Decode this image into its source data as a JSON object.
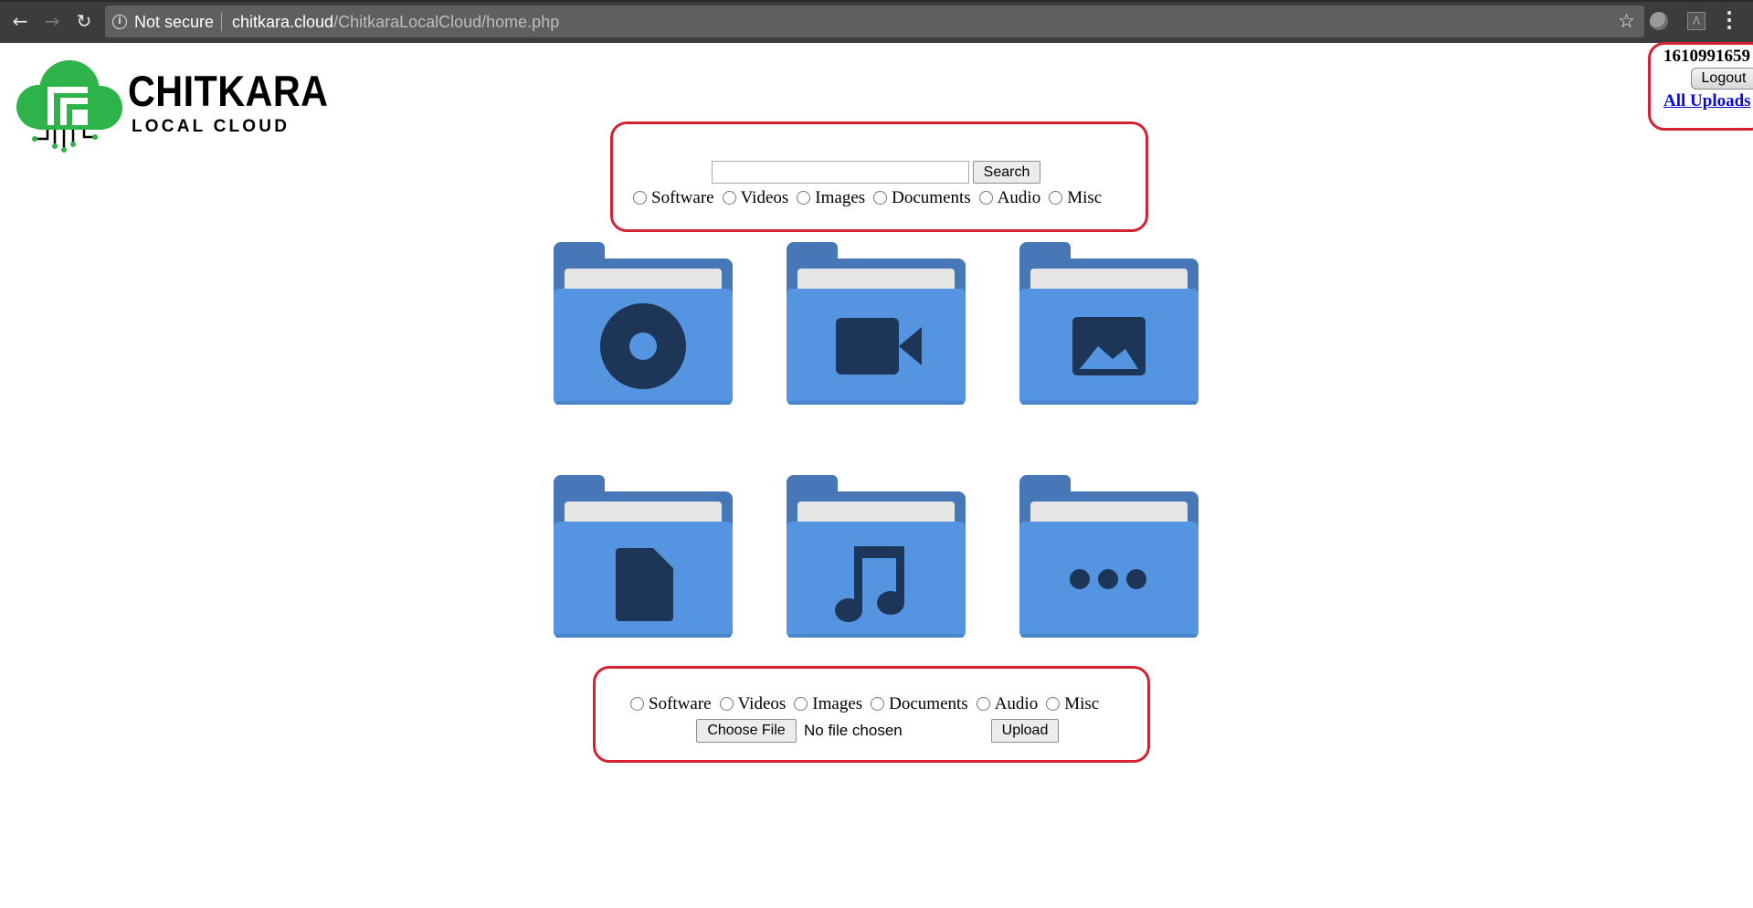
{
  "browser": {
    "security_label": "Not secure",
    "url_host": "chitkara.cloud",
    "url_path": "/ChitkaraLocalCloud/home.php"
  },
  "logo": {
    "title": "CHITKARA",
    "subtitle": "LOCAL CLOUD",
    "colors": {
      "cloud": "#2db34a",
      "text": "#000000"
    }
  },
  "user": {
    "id": "1610991659",
    "logout_label": "Logout",
    "all_uploads_label": "All Uploads"
  },
  "search": {
    "input_value": "",
    "button_label": "Search",
    "categories": [
      "Software",
      "Videos",
      "Images",
      "Documents",
      "Audio",
      "Misc"
    ]
  },
  "folders": [
    {
      "category": "Software",
      "icon": "disc-icon"
    },
    {
      "category": "Videos",
      "icon": "video-camera-icon"
    },
    {
      "category": "Images",
      "icon": "image-icon"
    },
    {
      "category": "Documents",
      "icon": "document-icon"
    },
    {
      "category": "Audio",
      "icon": "music-note-icon"
    },
    {
      "category": "Misc",
      "icon": "more-dots-icon"
    }
  ],
  "upload": {
    "categories": [
      "Software",
      "Videos",
      "Images",
      "Documents",
      "Audio",
      "Misc"
    ],
    "choose_file_label": "Choose File",
    "no_file_text": "No file chosen",
    "upload_label": "Upload"
  },
  "colors": {
    "highlight_border": "#d42233",
    "folder_back": "#4877b8",
    "folder_front": "#5594e0",
    "folder_paper": "#e6e6e6",
    "folder_icon": "#1d3557",
    "link": "#0b0bd0"
  }
}
